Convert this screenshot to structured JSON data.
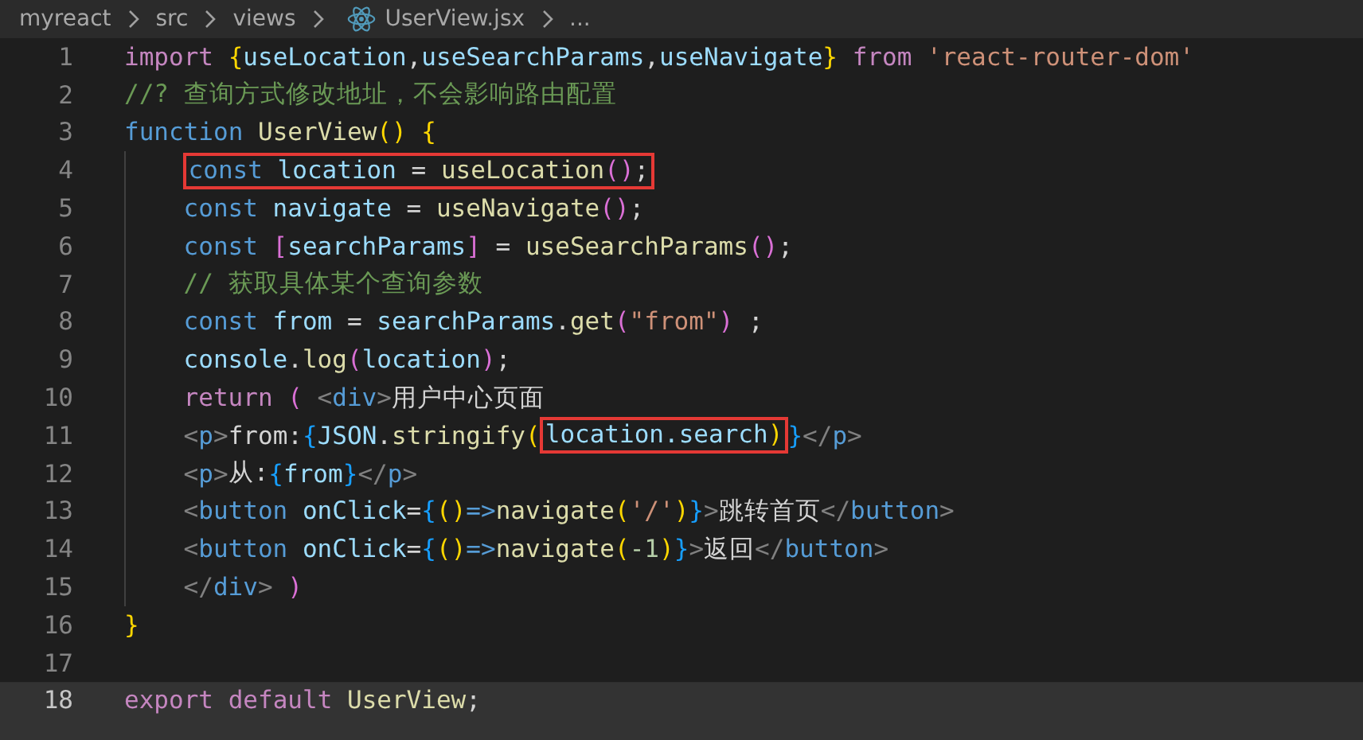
{
  "breadcrumb": [
    {
      "label": "myreact",
      "kind": "folder"
    },
    {
      "label": "src",
      "kind": "folder"
    },
    {
      "label": "views",
      "kind": "folder"
    },
    {
      "label": "UserView.jsx",
      "kind": "file"
    },
    {
      "label": "...",
      "kind": "more"
    }
  ],
  "lines": [
    {
      "number": "1",
      "current": false,
      "tokens": [
        {
          "text": "import ",
          "kind": "kw"
        },
        {
          "text": "{",
          "kind": "b1"
        },
        {
          "text": "useLocation",
          "kind": "var"
        },
        {
          "text": ",",
          "kind": "punc"
        },
        {
          "text": "useSearchParams",
          "kind": "var"
        },
        {
          "text": ",",
          "kind": "punc"
        },
        {
          "text": "useNavigate",
          "kind": "var"
        },
        {
          "text": "} ",
          "kind": "b1"
        },
        {
          "text": "from ",
          "kind": "kw"
        },
        {
          "text": "'react-router-dom'",
          "kind": "str"
        }
      ]
    },
    {
      "number": "2",
      "current": false,
      "tokens": [
        {
          "text": "//? 查询方式修改地址，不会影响路由配置",
          "kind": "cmt"
        }
      ]
    },
    {
      "number": "3",
      "current": false,
      "tokens": [
        {
          "text": "function ",
          "kind": "storage"
        },
        {
          "text": "UserView",
          "kind": "fn"
        },
        {
          "text": "() ",
          "kind": "b1"
        },
        {
          "text": "{",
          "kind": "b1"
        }
      ],
      "children": [
        {
          "number": "4",
          "current": false,
          "tokens": [
            {
              "kind": "group",
              "boxed": true,
              "tokens": [
                {
                  "text": "const ",
                  "kind": "storage"
                },
                {
                  "text": "location",
                  "kind": "var"
                },
                {
                  "text": " = ",
                  "kind": "punc"
                },
                {
                  "text": "useLocation",
                  "kind": "fn"
                },
                {
                  "text": "()",
                  "kind": "b2"
                },
                {
                  "text": ";",
                  "kind": "punc"
                }
              ]
            }
          ]
        },
        {
          "number": "5",
          "current": false,
          "tokens": [
            {
              "text": "const ",
              "kind": "storage"
            },
            {
              "text": "navigate",
              "kind": "var"
            },
            {
              "text": " = ",
              "kind": "punc"
            },
            {
              "text": "useNavigate",
              "kind": "fn"
            },
            {
              "text": "()",
              "kind": "b2"
            },
            {
              "text": ";",
              "kind": "punc"
            }
          ]
        },
        {
          "number": "6",
          "current": false,
          "tokens": [
            {
              "text": "const ",
              "kind": "storage"
            },
            {
              "text": "[",
              "kind": "b2"
            },
            {
              "text": "searchParams",
              "kind": "var"
            },
            {
              "text": "]",
              "kind": "b2"
            },
            {
              "text": " = ",
              "kind": "punc"
            },
            {
              "text": "useSearchParams",
              "kind": "fn"
            },
            {
              "text": "()",
              "kind": "b2"
            },
            {
              "text": ";",
              "kind": "punc"
            }
          ]
        },
        {
          "number": "7",
          "current": false,
          "tokens": [
            {
              "text": "// 获取具体某个查询参数",
              "kind": "cmt"
            }
          ]
        },
        {
          "number": "8",
          "current": false,
          "tokens": [
            {
              "text": "const ",
              "kind": "storage"
            },
            {
              "text": "from",
              "kind": "var"
            },
            {
              "text": " = ",
              "kind": "punc"
            },
            {
              "text": "searchParams",
              "kind": "var"
            },
            {
              "text": ".",
              "kind": "punc"
            },
            {
              "text": "get",
              "kind": "fn"
            },
            {
              "text": "(",
              "kind": "b2"
            },
            {
              "text": "\"from\"",
              "kind": "str"
            },
            {
              "text": ")",
              "kind": "b2"
            },
            {
              "text": " ;",
              "kind": "punc"
            }
          ]
        },
        {
          "number": "9",
          "current": false,
          "tokens": [
            {
              "text": "console",
              "kind": "var"
            },
            {
              "text": ".",
              "kind": "punc"
            },
            {
              "text": "log",
              "kind": "fn"
            },
            {
              "text": "(",
              "kind": "b2"
            },
            {
              "text": "location",
              "kind": "var"
            },
            {
              "text": ")",
              "kind": "b2"
            },
            {
              "text": ";",
              "kind": "punc"
            }
          ]
        },
        {
          "number": "10",
          "current": false,
          "tokens": [
            {
              "text": "return ",
              "kind": "kw"
            },
            {
              "text": "( ",
              "kind": "b2"
            },
            {
              "text": "<",
              "kind": "angle"
            },
            {
              "text": "div",
              "kind": "tag"
            },
            {
              "text": ">",
              "kind": "angle"
            },
            {
              "text": "用户中心页面",
              "kind": "text"
            }
          ]
        },
        {
          "number": "11",
          "current": false,
          "tokens": [
            {
              "text": "<",
              "kind": "angle"
            },
            {
              "text": "p",
              "kind": "tag"
            },
            {
              "text": ">",
              "kind": "angle"
            },
            {
              "text": "from:",
              "kind": "text"
            },
            {
              "text": "{",
              "kind": "b3"
            },
            {
              "text": "JSON",
              "kind": "var"
            },
            {
              "text": ".",
              "kind": "punc"
            },
            {
              "text": "stringify",
              "kind": "fn"
            },
            {
              "text": "(",
              "kind": "b1"
            },
            {
              "kind": "group",
              "boxed": true,
              "tokens": [
                {
                  "text": "location.search",
                  "kind": "var"
                },
                {
                  "text": ")",
                  "kind": "b1"
                }
              ]
            },
            {
              "text": "}",
              "kind": "b3"
            },
            {
              "text": "</",
              "kind": "angle"
            },
            {
              "text": "p",
              "kind": "tag"
            },
            {
              "text": ">",
              "kind": "angle"
            }
          ]
        },
        {
          "number": "12",
          "current": false,
          "tokens": [
            {
              "text": "<",
              "kind": "angle"
            },
            {
              "text": "p",
              "kind": "tag"
            },
            {
              "text": ">",
              "kind": "angle"
            },
            {
              "text": "从:",
              "kind": "text"
            },
            {
              "text": "{",
              "kind": "b3"
            },
            {
              "text": "from",
              "kind": "var"
            },
            {
              "text": "}",
              "kind": "b3"
            },
            {
              "text": "</",
              "kind": "angle"
            },
            {
              "text": "p",
              "kind": "tag"
            },
            {
              "text": ">",
              "kind": "angle"
            }
          ]
        },
        {
          "number": "13",
          "current": false,
          "tokens": [
            {
              "text": "<",
              "kind": "angle"
            },
            {
              "text": "button ",
              "kind": "tag"
            },
            {
              "text": "onClick",
              "kind": "var"
            },
            {
              "text": "=",
              "kind": "punc"
            },
            {
              "text": "{",
              "kind": "b3"
            },
            {
              "text": "()",
              "kind": "b1"
            },
            {
              "text": "=>",
              "kind": "storage"
            },
            {
              "text": "navigate",
              "kind": "fn"
            },
            {
              "text": "(",
              "kind": "b1"
            },
            {
              "text": "'/'",
              "kind": "str"
            },
            {
              "text": ")",
              "kind": "b1"
            },
            {
              "text": "}",
              "kind": "b3"
            },
            {
              "text": ">",
              "kind": "angle"
            },
            {
              "text": "跳转首页",
              "kind": "text"
            },
            {
              "text": "</",
              "kind": "angle"
            },
            {
              "text": "button",
              "kind": "tag"
            },
            {
              "text": ">",
              "kind": "angle"
            }
          ]
        },
        {
          "number": "14",
          "current": false,
          "tokens": [
            {
              "text": "<",
              "kind": "angle"
            },
            {
              "text": "button ",
              "kind": "tag"
            },
            {
              "text": "onClick",
              "kind": "var"
            },
            {
              "text": "=",
              "kind": "punc"
            },
            {
              "text": "{",
              "kind": "b3"
            },
            {
              "text": "()",
              "kind": "b1"
            },
            {
              "text": "=>",
              "kind": "storage"
            },
            {
              "text": "navigate",
              "kind": "fn"
            },
            {
              "text": "(",
              "kind": "b1"
            },
            {
              "text": "-1",
              "kind": "num"
            },
            {
              "text": ")",
              "kind": "b1"
            },
            {
              "text": "}",
              "kind": "b3"
            },
            {
              "text": ">",
              "kind": "angle"
            },
            {
              "text": "返回",
              "kind": "text"
            },
            {
              "text": "</",
              "kind": "angle"
            },
            {
              "text": "button",
              "kind": "tag"
            },
            {
              "text": ">",
              "kind": "angle"
            }
          ]
        },
        {
          "number": "15",
          "current": false,
          "tokens": [
            {
              "text": "</",
              "kind": "angle"
            },
            {
              "text": "div",
              "kind": "tag"
            },
            {
              "text": "> ",
              "kind": "angle"
            },
            {
              "text": ")",
              "kind": "b2"
            }
          ]
        }
      ]
    },
    {
      "number": "16",
      "current": false,
      "tokens": [
        {
          "text": "}",
          "kind": "b1"
        }
      ]
    },
    {
      "number": "17",
      "current": false
    },
    {
      "number": "18",
      "current": true,
      "tokens": [
        {
          "text": "export ",
          "kind": "kw"
        },
        {
          "text": "default ",
          "kind": "kw"
        },
        {
          "text": "UserView",
          "kind": "fn"
        },
        {
          "text": ";",
          "kind": "punc"
        }
      ]
    }
  ]
}
